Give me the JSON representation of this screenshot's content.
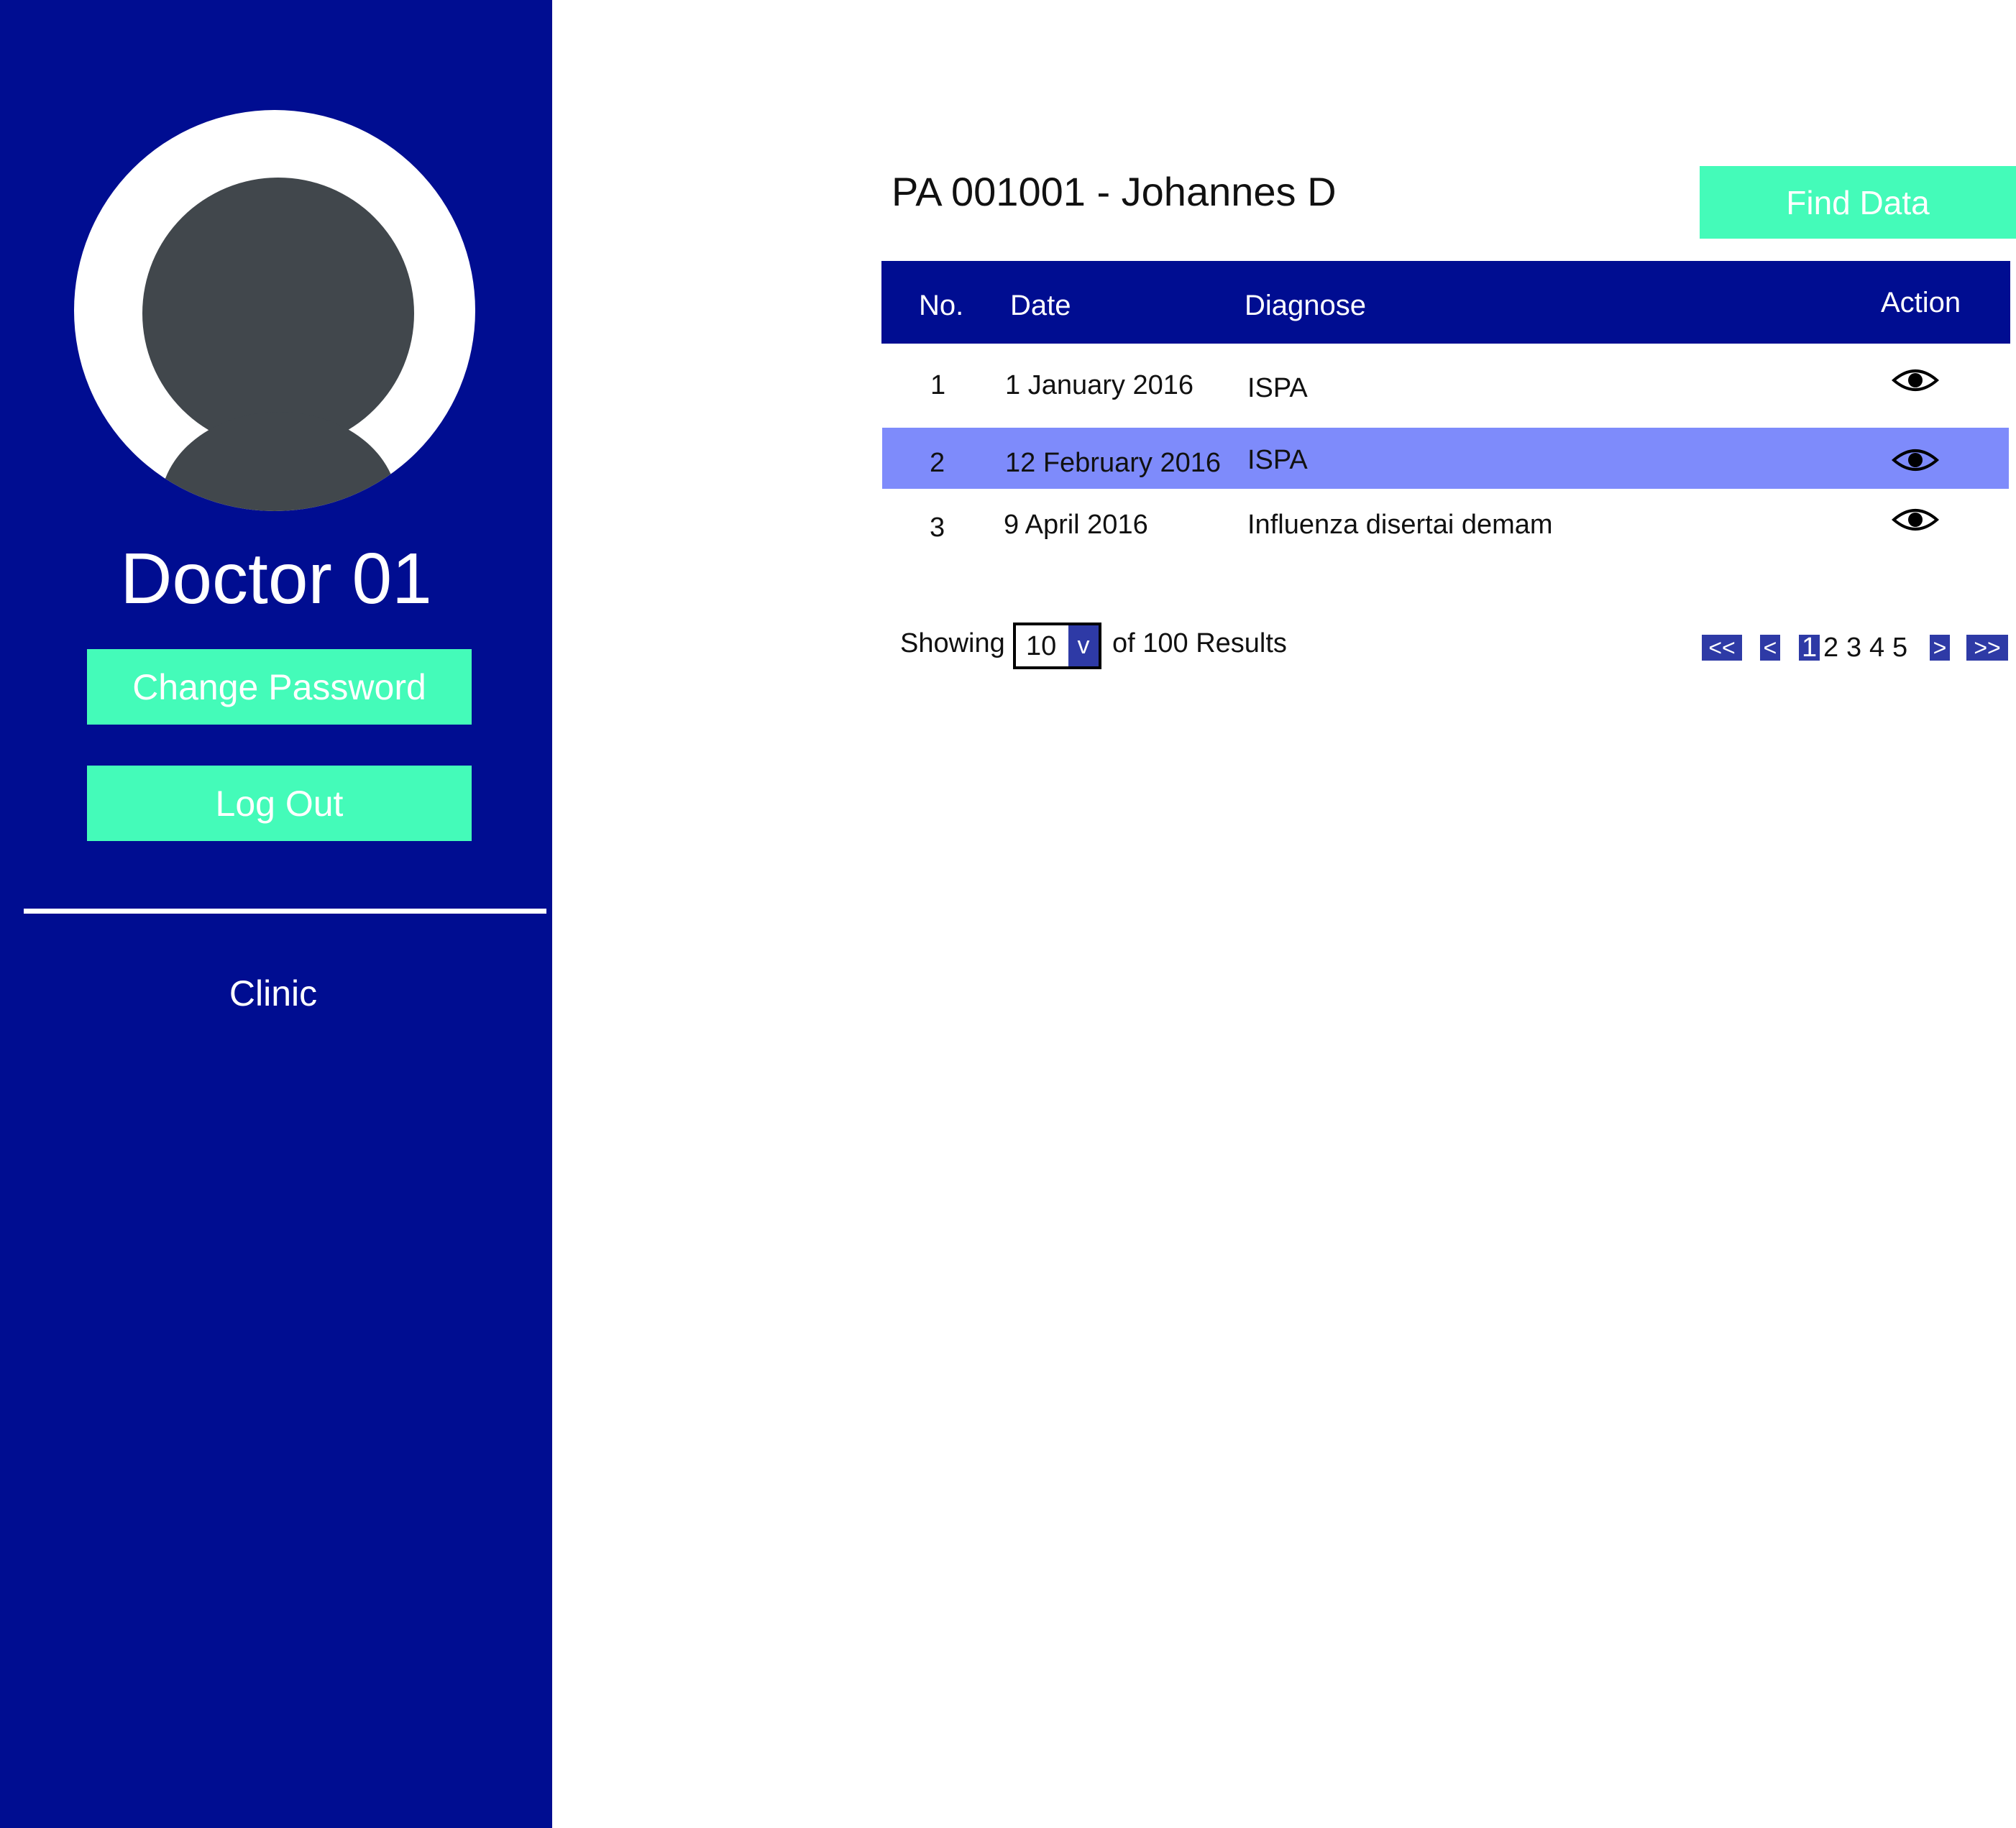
{
  "sidebar": {
    "doctor_name": "Doctor 01",
    "change_password_label": "Change Password",
    "logout_label": "Log Out",
    "nav_items": [
      {
        "label": "Clinic"
      }
    ]
  },
  "main": {
    "patient_title": "PA 001001 - Johannes D",
    "find_button_label": "Find Data",
    "table": {
      "columns": [
        "No.",
        "Date",
        "Diagnose",
        "Action"
      ],
      "rows": [
        {
          "no": "1",
          "date": "1 January 2016",
          "diagnose": "ISPA",
          "action_icon": "eye-icon"
        },
        {
          "no": "2",
          "date": "12 February 2016",
          "diagnose": "ISPA",
          "action_icon": "eye-icon",
          "highlighted": true
        },
        {
          "no": "3",
          "date": "9 April 2016",
          "diagnose": "Influenza disertai demam",
          "action_icon": "eye-icon"
        }
      ]
    },
    "footer": {
      "showing_label": "Showing",
      "page_size": "10",
      "page_size_arrow": "v",
      "results_label": "of 100 Results"
    },
    "pagination": {
      "first": "<<",
      "prev": "<",
      "pages": [
        "1",
        "2",
        "3",
        "4",
        "5"
      ],
      "current_page": "1",
      "next": ">",
      "last": ">>"
    }
  },
  "colors": {
    "sidebar_bg": "#000d91",
    "accent_button": "#44fbb9",
    "row_highlight": "#7e8bfb",
    "pagination_bg": "#2e3aa6",
    "avatar_gray": "#41474c"
  }
}
